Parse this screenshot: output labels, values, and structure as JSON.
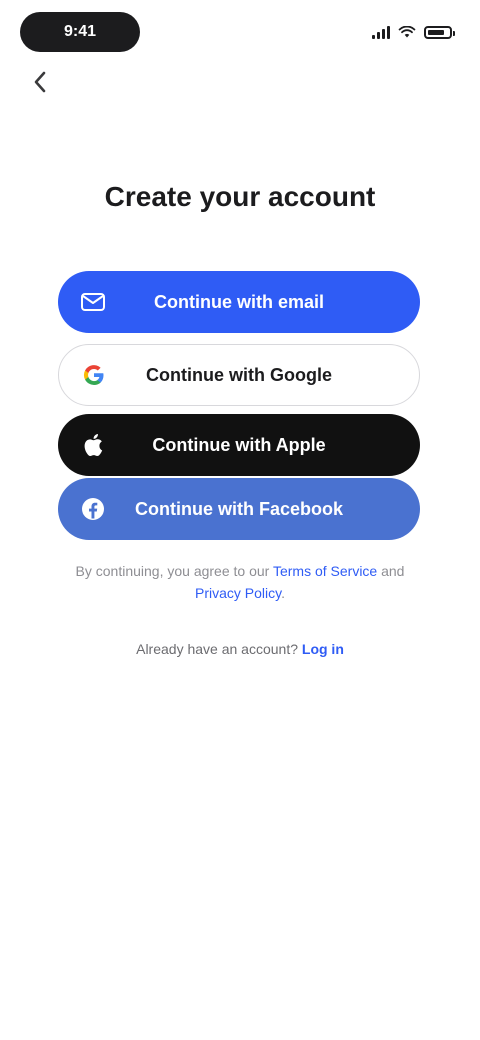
{
  "status_bar": {
    "time": "9:41"
  },
  "screen": {
    "title": "Create your account"
  },
  "buttons": {
    "email": {
      "label": "Continue with email",
      "icon": "mail-icon"
    },
    "google": {
      "label": "Continue with Google",
      "icon": "google-icon"
    },
    "apple": {
      "label": "Continue with Apple",
      "icon": "apple-icon"
    },
    "facebook": {
      "label": "Continue with Facebook",
      "icon": "facebook-icon"
    }
  },
  "terms": {
    "prefix": "By continuing, you agree to our ",
    "terms_link": "Terms of Service",
    "middle": " and ",
    "privacy_link": "Privacy Policy",
    "suffix": "."
  },
  "signin": {
    "prompt": "Already have an account? ",
    "link": "Log in"
  },
  "colors": {
    "primary": "#2f5cf5",
    "apple": "#111111",
    "facebook": "#4a72d0"
  }
}
